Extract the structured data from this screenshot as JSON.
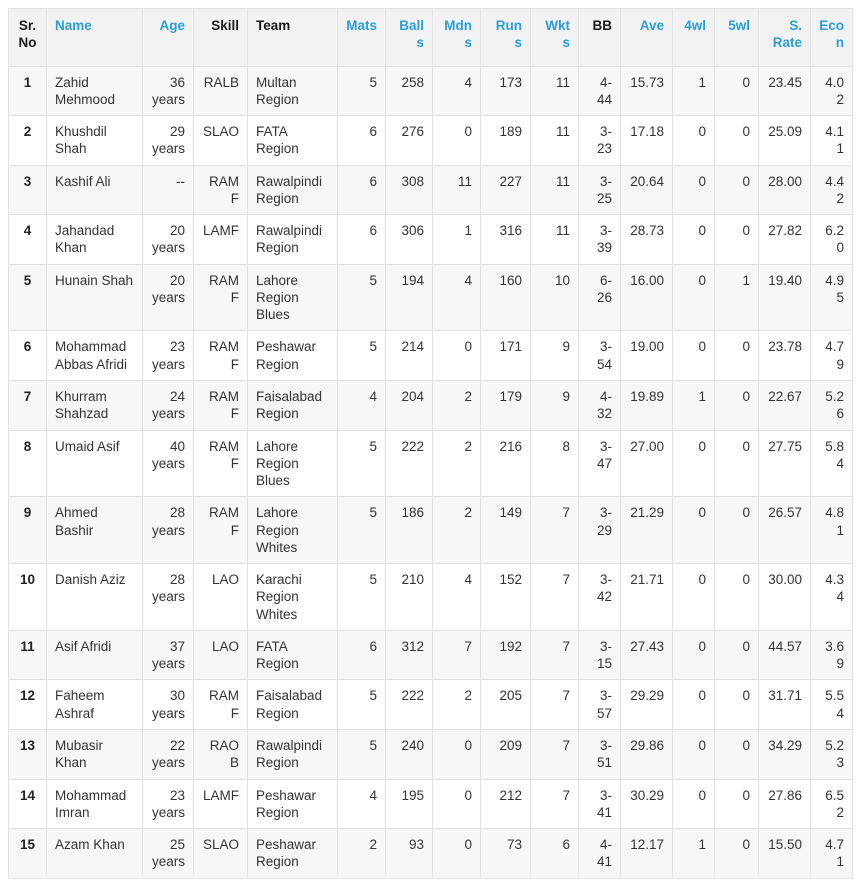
{
  "table": {
    "name": "bowling-statistics-table",
    "accent_color": "#2a9fd6",
    "header_bg": "#f2f2f2",
    "stripe_color": "#f7f7f7",
    "border_color": "#e2e2e2",
    "columns": [
      {
        "key": "srno",
        "label": "Sr. No",
        "link": false,
        "align": "center"
      },
      {
        "key": "name",
        "label": "Name",
        "link": true,
        "align": "left"
      },
      {
        "key": "age",
        "label": "Age",
        "link": true,
        "align": "right"
      },
      {
        "key": "skill",
        "label": "Skill",
        "link": false,
        "align": "right"
      },
      {
        "key": "team",
        "label": "Team",
        "link": false,
        "align": "left"
      },
      {
        "key": "mats",
        "label": "Mats",
        "link": true,
        "align": "right"
      },
      {
        "key": "balls",
        "label": "Balls",
        "link": true,
        "align": "right"
      },
      {
        "key": "mdns",
        "label": "Mdns",
        "link": true,
        "align": "right"
      },
      {
        "key": "runs",
        "label": "Runs",
        "link": true,
        "align": "right"
      },
      {
        "key": "wkts",
        "label": "Wkts",
        "link": true,
        "align": "right"
      },
      {
        "key": "bb",
        "label": "BB",
        "link": false,
        "align": "right"
      },
      {
        "key": "ave",
        "label": "Ave",
        "link": true,
        "align": "right"
      },
      {
        "key": "fourwl",
        "label": "4wl",
        "link": true,
        "align": "right"
      },
      {
        "key": "fivewl",
        "label": "5wl",
        "link": true,
        "align": "right"
      },
      {
        "key": "srate",
        "label": "S. Rate",
        "link": true,
        "align": "right"
      },
      {
        "key": "econ",
        "label": "Econ",
        "link": true,
        "align": "right"
      }
    ],
    "rows": [
      {
        "srno": "1",
        "name": "Zahid Mehmood",
        "age": "36",
        "age_unit": "years",
        "skill": "RALB",
        "team": "Multan Region",
        "mats": "5",
        "balls": "258",
        "mdns": "4",
        "runs": "173",
        "wkts": "11",
        "bb_a": "4-",
        "bb_b": "44",
        "ave": "15.73",
        "fourwl": "1",
        "fivewl": "0",
        "srate": "23.45",
        "econ": "4.02"
      },
      {
        "srno": "2",
        "name": "Khushdil Shah",
        "age": "29",
        "age_unit": "years",
        "skill": "SLAO",
        "team": "FATA Region",
        "mats": "6",
        "balls": "276",
        "mdns": "0",
        "runs": "189",
        "wkts": "11",
        "bb_a": "3-",
        "bb_b": "23",
        "ave": "17.18",
        "fourwl": "0",
        "fivewl": "0",
        "srate": "25.09",
        "econ": "4.11"
      },
      {
        "srno": "3",
        "name": "Kashif Ali",
        "age": "--",
        "age_unit": "",
        "skill": "RAMF",
        "team": "Rawalpindi Region",
        "mats": "6",
        "balls": "308",
        "mdns": "11",
        "runs": "227",
        "wkts": "11",
        "bb_a": "3-",
        "bb_b": "25",
        "ave": "20.64",
        "fourwl": "0",
        "fivewl": "0",
        "srate": "28.00",
        "econ": "4.42"
      },
      {
        "srno": "4",
        "name": "Jahandad Khan",
        "age": "20",
        "age_unit": "years",
        "skill": "LAMF",
        "team": "Rawalpindi Region",
        "mats": "6",
        "balls": "306",
        "mdns": "1",
        "runs": "316",
        "wkts": "11",
        "bb_a": "3-",
        "bb_b": "39",
        "ave": "28.73",
        "fourwl": "0",
        "fivewl": "0",
        "srate": "27.82",
        "econ": "6.20"
      },
      {
        "srno": "5",
        "name": "Hunain Shah",
        "age": "20",
        "age_unit": "years",
        "skill": "RAMF",
        "team": "Lahore Region Blues",
        "mats": "5",
        "balls": "194",
        "mdns": "4",
        "runs": "160",
        "wkts": "10",
        "bb_a": "6-",
        "bb_b": "26",
        "ave": "16.00",
        "fourwl": "0",
        "fivewl": "1",
        "srate": "19.40",
        "econ": "4.95"
      },
      {
        "srno": "6",
        "name": "Mohammad Abbas Afridi",
        "age": "23",
        "age_unit": "years",
        "skill": "RAMF",
        "team": "Peshawar Region",
        "mats": "5",
        "balls": "214",
        "mdns": "0",
        "runs": "171",
        "wkts": "9",
        "bb_a": "3-",
        "bb_b": "54",
        "ave": "19.00",
        "fourwl": "0",
        "fivewl": "0",
        "srate": "23.78",
        "econ": "4.79"
      },
      {
        "srno": "7",
        "name": "Khurram Shahzad",
        "age": "24",
        "age_unit": "years",
        "skill": "RAMF",
        "team": "Faisalabad Region",
        "mats": "4",
        "balls": "204",
        "mdns": "2",
        "runs": "179",
        "wkts": "9",
        "bb_a": "4-",
        "bb_b": "32",
        "ave": "19.89",
        "fourwl": "1",
        "fivewl": "0",
        "srate": "22.67",
        "econ": "5.26"
      },
      {
        "srno": "8",
        "name": "Umaid Asif",
        "age": "40",
        "age_unit": "years",
        "skill": "RAMF",
        "team": "Lahore Region Blues",
        "mats": "5",
        "balls": "222",
        "mdns": "2",
        "runs": "216",
        "wkts": "8",
        "bb_a": "3-",
        "bb_b": "47",
        "ave": "27.00",
        "fourwl": "0",
        "fivewl": "0",
        "srate": "27.75",
        "econ": "5.84"
      },
      {
        "srno": "9",
        "name": "Ahmed Bashir",
        "age": "28",
        "age_unit": "years",
        "skill": "RAMF",
        "team": "Lahore Region Whites",
        "mats": "5",
        "balls": "186",
        "mdns": "2",
        "runs": "149",
        "wkts": "7",
        "bb_a": "3-",
        "bb_b": "29",
        "ave": "21.29",
        "fourwl": "0",
        "fivewl": "0",
        "srate": "26.57",
        "econ": "4.81"
      },
      {
        "srno": "10",
        "name": "Danish Aziz",
        "age": "28",
        "age_unit": "years",
        "skill": "LAO",
        "team": "Karachi Region Whites",
        "mats": "5",
        "balls": "210",
        "mdns": "4",
        "runs": "152",
        "wkts": "7",
        "bb_a": "3-",
        "bb_b": "42",
        "ave": "21.71",
        "fourwl": "0",
        "fivewl": "0",
        "srate": "30.00",
        "econ": "4.34"
      },
      {
        "srno": "11",
        "name": "Asif Afridi",
        "age": "37",
        "age_unit": "years",
        "skill": "LAO",
        "team": "FATA Region",
        "mats": "6",
        "balls": "312",
        "mdns": "7",
        "runs": "192",
        "wkts": "7",
        "bb_a": "3-",
        "bb_b": "15",
        "ave": "27.43",
        "fourwl": "0",
        "fivewl": "0",
        "srate": "44.57",
        "econ": "3.69"
      },
      {
        "srno": "12",
        "name": "Faheem Ashraf",
        "age": "30",
        "age_unit": "years",
        "skill": "RAMF",
        "team": "Faisalabad Region",
        "mats": "5",
        "balls": "222",
        "mdns": "2",
        "runs": "205",
        "wkts": "7",
        "bb_a": "3-",
        "bb_b": "57",
        "ave": "29.29",
        "fourwl": "0",
        "fivewl": "0",
        "srate": "31.71",
        "econ": "5.54"
      },
      {
        "srno": "13",
        "name": "Mubasir Khan",
        "age": "22",
        "age_unit": "years",
        "skill": "RAOB",
        "team": "Rawalpindi Region",
        "mats": "5",
        "balls": "240",
        "mdns": "0",
        "runs": "209",
        "wkts": "7",
        "bb_a": "3-",
        "bb_b": "51",
        "ave": "29.86",
        "fourwl": "0",
        "fivewl": "0",
        "srate": "34.29",
        "econ": "5.23"
      },
      {
        "srno": "14",
        "name": "Mohammad Imran",
        "age": "23",
        "age_unit": "years",
        "skill": "LAMF",
        "team": "Peshawar Region",
        "mats": "4",
        "balls": "195",
        "mdns": "0",
        "runs": "212",
        "wkts": "7",
        "bb_a": "3-",
        "bb_b": "41",
        "ave": "30.29",
        "fourwl": "0",
        "fivewl": "0",
        "srate": "27.86",
        "econ": "6.52"
      },
      {
        "srno": "15",
        "name": "Azam Khan",
        "age": "25",
        "age_unit": "years",
        "skill": "SLAO",
        "team": "Peshawar Region",
        "mats": "2",
        "balls": "93",
        "mdns": "0",
        "runs": "73",
        "wkts": "6",
        "bb_a": "4-",
        "bb_b": "41",
        "ave": "12.17",
        "fourwl": "1",
        "fivewl": "0",
        "srate": "15.50",
        "econ": "4.71"
      }
    ]
  }
}
